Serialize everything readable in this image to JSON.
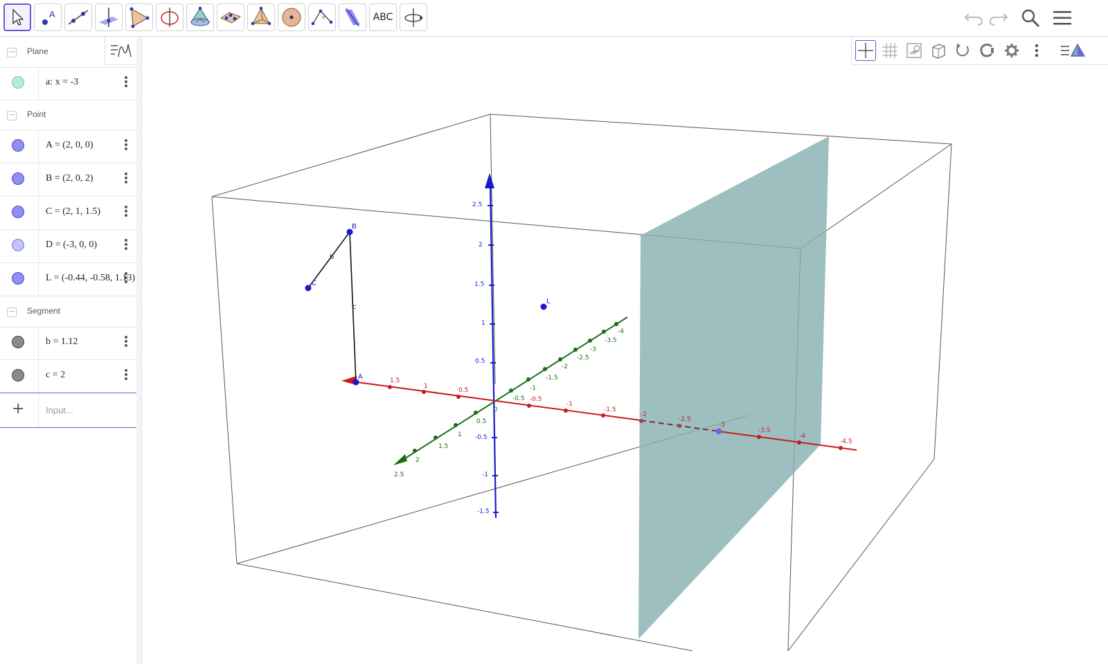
{
  "toolbar": {
    "tools": [
      "move",
      "point",
      "line",
      "perpendicular-line",
      "polygon",
      "circle-axis",
      "pyramid",
      "intersect-surfaces",
      "tetrahedron",
      "sphere",
      "angle",
      "plane",
      "text",
      "rotate-view"
    ],
    "text_tool_label": "ABC",
    "active_tool": "move"
  },
  "algebra": {
    "groups": [
      {
        "name": "Plane",
        "items": [
          {
            "expr": "a: x = -3",
            "color": "#b5ece0"
          }
        ]
      },
      {
        "name": "Point",
        "items": [
          {
            "expr": "A = (2, 0, 0)",
            "color": "#8f8ff5"
          },
          {
            "expr": "B = (2, 0, 2)",
            "color": "#8f8ff5"
          },
          {
            "expr": "C = (2, 1, 1.5)",
            "color": "#8f8ff5"
          },
          {
            "expr": "D = (-3, 0, 0)",
            "color": "#c4c4fb"
          },
          {
            "expr": "L = (-0.44, -0.58, 1.13)",
            "color": "#8f8ff5"
          }
        ]
      },
      {
        "name": "Segment",
        "items": [
          {
            "expr": "b = 1.12",
            "color": "#8a8a8a"
          },
          {
            "expr": "c = 2",
            "color": "#8a8a8a"
          }
        ]
      }
    ],
    "input_placeholder": "Input..."
  },
  "graphics": {
    "axis_colors": {
      "x": "#cc0000",
      "y": "#006400",
      "z": "#0000cc"
    },
    "plane_color": "#87b1b1",
    "point_labels": [
      "A",
      "B",
      "C",
      "L"
    ],
    "segment_labels": [
      "b",
      "c"
    ],
    "origin_label": "0",
    "x_tick_labels": [
      "1.5",
      "1",
      "0.5",
      "-0.5",
      "-1",
      "-1.5",
      "-2",
      "-2.5",
      "-3",
      "-3.5",
      "-4",
      "-4.5"
    ],
    "y_tick_labels": [
      "2.5",
      "2",
      "1.5",
      "1",
      "0.5",
      "-0.5",
      "-1",
      "-1.5",
      "-2",
      "-2.5",
      "-3",
      "-3.5",
      "-4"
    ],
    "z_tick_labels": [
      "2.5",
      "2",
      "1.5",
      "1",
      "0.5",
      "-0.5",
      "-1",
      "-1.5"
    ]
  }
}
